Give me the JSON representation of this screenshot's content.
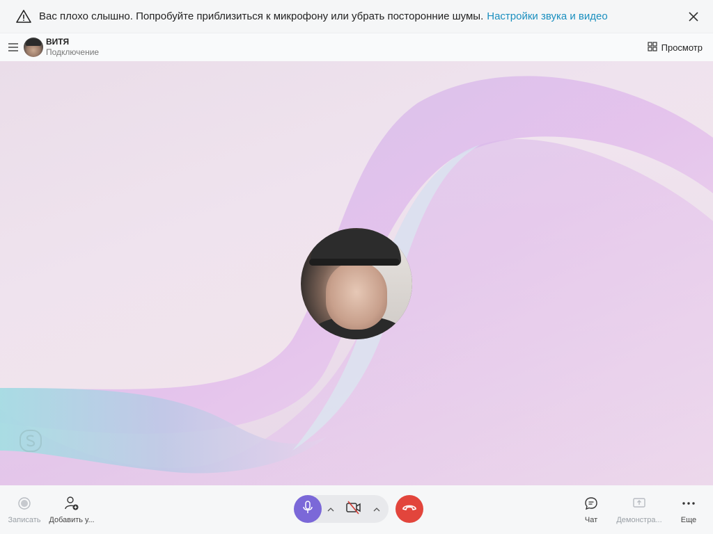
{
  "notice": {
    "message": "Вас плохо слышно. Попробуйте приблизиться к микрофону или убрать посторонние шумы.",
    "link": "Настройки звука и видео",
    "link_color": "#1a8fbf"
  },
  "header": {
    "contact_name": "ВИТЯ",
    "status": "Подключение",
    "view_label": "Просмотр"
  },
  "toolbar": {
    "record_label": "Записать",
    "add_people_label": "Добавить у...",
    "chat_label": "Чат",
    "share_label": "Демонстра...",
    "more_label": "Еще"
  },
  "colors": {
    "mic_active": "#7b68d8",
    "hangup": "#e2453c"
  },
  "icons": [
    "warning-icon",
    "close-icon",
    "hamburger-icon",
    "grid-view-icon",
    "record-icon",
    "add-person-icon",
    "microphone-icon",
    "chevron-up-icon",
    "camera-off-icon",
    "hang-up-icon",
    "chat-icon",
    "screen-share-icon",
    "more-icon",
    "skype-logo-icon"
  ]
}
